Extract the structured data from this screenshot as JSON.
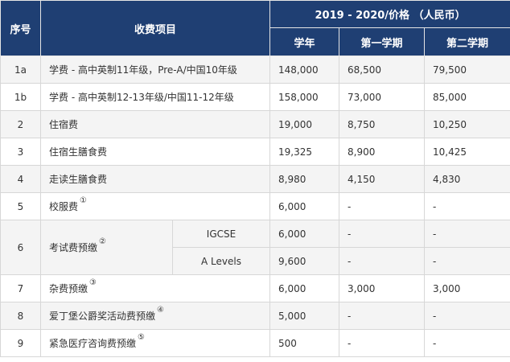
{
  "header": {
    "seq": "序号",
    "item": "收费项目",
    "price_group": "2019 - 2020/价格  （人民币）",
    "year": "学年",
    "sem1": "第一学期",
    "sem2": "第二学期"
  },
  "rows": [
    {
      "no": "1a",
      "item": "学费 - 高中英制11年级，Pre-A/中国10年级",
      "year": "148,000",
      "sem1": "68,500",
      "sem2": "79,500"
    },
    {
      "no": "1b",
      "item": "学费 - 高中英制12-13年级/中国11-12年级",
      "year": "158,000",
      "sem1": "73,000",
      "sem2": "85,000"
    },
    {
      "no": "2",
      "item": "住宿费",
      "year": "19,000",
      "sem1": "8,750",
      "sem2": "10,250"
    },
    {
      "no": "3",
      "item": "住宿生膳食费",
      "year": "19,325",
      "sem1": "8,900",
      "sem2": "10,425"
    },
    {
      "no": "4",
      "item": "走读生膳食费",
      "year": "8,980",
      "sem1": "4,150",
      "sem2": "4,830"
    },
    {
      "no": "5",
      "item": "校服费",
      "note": "①",
      "year": "6,000",
      "sem1": "-",
      "sem2": "-"
    },
    {
      "no": "6",
      "item": "考试费预缴",
      "note": "②",
      "sub": [
        {
          "name": "IGCSE",
          "year": "6,000",
          "sem1": "-",
          "sem2": "-"
        },
        {
          "name": "A Levels",
          "year": "9,600",
          "sem1": "-",
          "sem2": "-"
        }
      ]
    },
    {
      "no": "7",
      "item": "杂费预缴",
      "note": "③",
      "year": "6,000",
      "sem1": "3,000",
      "sem2": "3,000"
    },
    {
      "no": "8",
      "item": "爱丁堡公爵奖活动费预缴",
      "note": "④",
      "year": "5,000",
      "sem1": "-",
      "sem2": "-"
    },
    {
      "no": "9",
      "item": "紧急医疗咨询费预缴",
      "note": "⑤",
      "year": "500",
      "sem1": "-",
      "sem2": "-"
    }
  ]
}
